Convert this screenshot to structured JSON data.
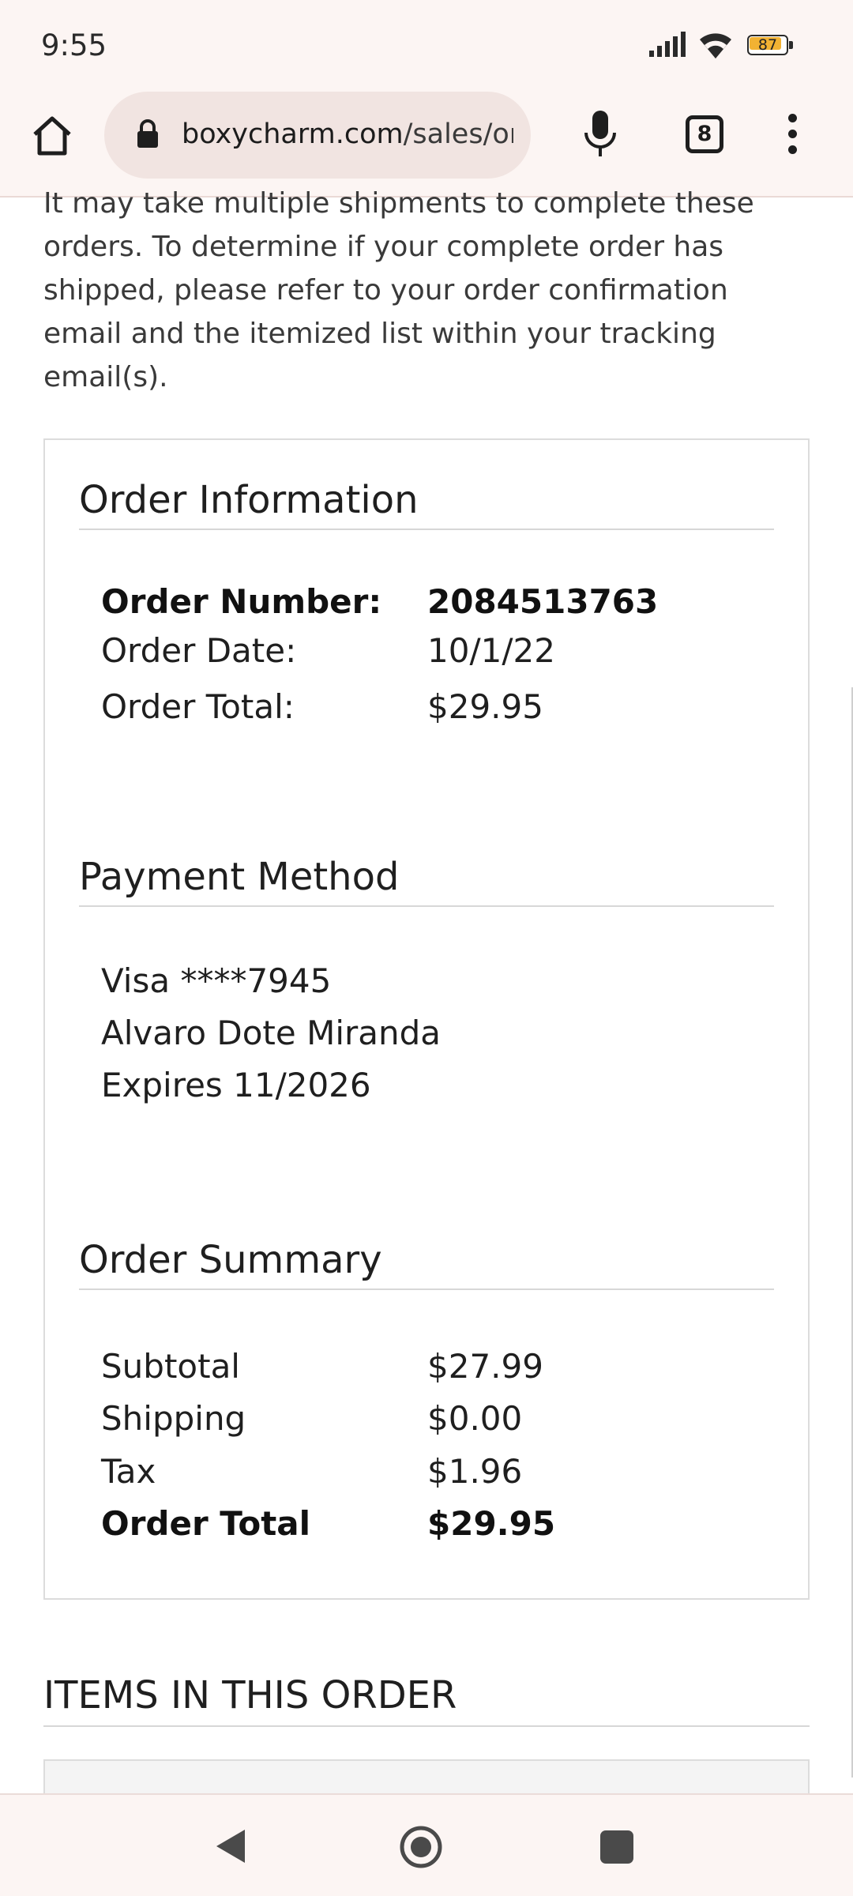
{
  "status_bar": {
    "time": "9:55",
    "battery": "87",
    "battery_level": 0.87,
    "icons": [
      "signal-icon",
      "wifi-icon",
      "battery-icon"
    ]
  },
  "browser": {
    "url_domain": "boxycharm.com",
    "url_path": "/sales/orc",
    "tab_count": "8",
    "icons": [
      "home-icon",
      "lock-icon",
      "mic-icon",
      "tabs-icon",
      "menu-icon"
    ]
  },
  "intro_text": "It may take multiple shipments to complete these orders. To determine if your complete order has shipped, please refer to your order confirmation email and the itemized list within your tracking email(s).",
  "order_information": {
    "title": "Order Information",
    "number_label": "Order Number:",
    "number_value": "2084513763",
    "date_label": "Order Date:",
    "date_value": "10/1/22",
    "total_label": "Order Total:",
    "total_value": "$29.95"
  },
  "payment_method": {
    "title": "Payment Method",
    "card": "Visa ****7945",
    "name": "Alvaro Dote Miranda",
    "expires": "Expires 11/2026"
  },
  "order_summary": {
    "title": "Order Summary",
    "subtotal_label": "Subtotal",
    "subtotal_value": "$27.99",
    "shipping_label": "Shipping",
    "shipping_value": "$0.00",
    "tax_label": "Tax",
    "tax_value": "$1.96",
    "total_label": "Order Total",
    "total_value": "$29.95"
  },
  "items_title": "ITEMS IN THIS ORDER",
  "nav_bar": {
    "icons": [
      "back-icon",
      "home-icon",
      "recents-icon"
    ]
  }
}
